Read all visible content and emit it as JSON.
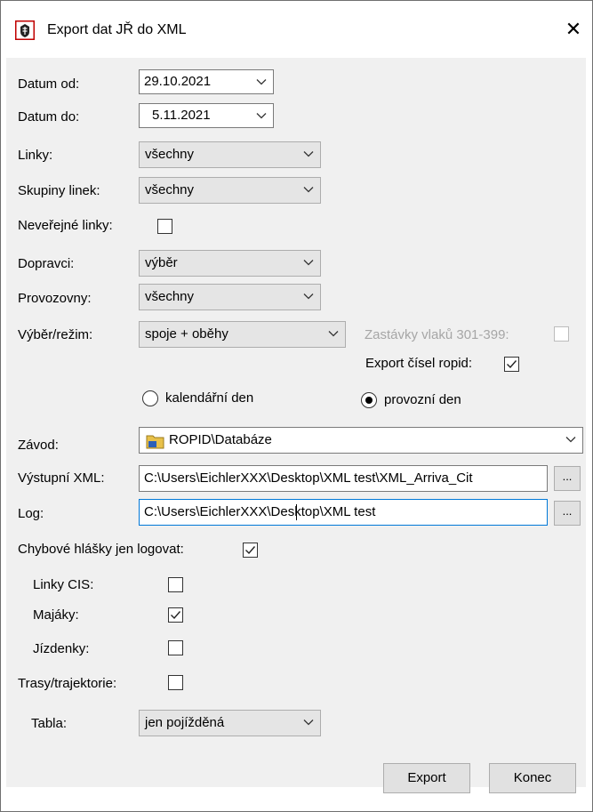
{
  "window": {
    "title": "Export dat JŘ do XML",
    "close_glyph": "✕",
    "icon": "app-icon"
  },
  "form": {
    "datum_od": {
      "label": "Datum od:",
      "value": "29.10.2021"
    },
    "datum_do": {
      "label": "Datum do:",
      "value": "5.11.2021"
    },
    "linky": {
      "label": "Linky:",
      "value": "všechny"
    },
    "skupiny_linek": {
      "label": "Skupiny linek:",
      "value": "všechny"
    },
    "neverejne_linky": {
      "label": "Neveřejné linky:",
      "checked": false
    },
    "dopravci": {
      "label": "Dopravci:",
      "value": "výběr"
    },
    "provozovny": {
      "label": "Provozovny:",
      "value": "všechny"
    },
    "vyber_rezim": {
      "label": "Výběr/režim:",
      "value": "spoje + oběhy"
    },
    "zastavky_vlaku": {
      "label": "Zastávky vlaků 301-399:",
      "checked": false,
      "enabled": false
    },
    "export_cisel_ropid": {
      "label": "Export čísel ropid:",
      "checked": true
    },
    "day_mode": {
      "options": [
        "kalendářní den",
        "provozní den"
      ],
      "selected": "provozní den"
    },
    "zavod": {
      "label": "Závod:",
      "value": "ROPID\\Databáze"
    },
    "vystupni_xml": {
      "label": "Výstupní XML:",
      "value": "C:\\Users\\EichlerXXX\\Desktop\\XML test\\XML_Arriva_Cit",
      "browse": "..."
    },
    "log": {
      "label": "Log:",
      "value": "C:\\Users\\EichlerXXX\\Desktop\\XML test",
      "browse": "..."
    },
    "chybove_hlasky": {
      "label": "Chybové hlášky jen logovat:",
      "checked": true
    },
    "linky_cis": {
      "label": "Linky CIS:",
      "checked": false
    },
    "majaky": {
      "label": "Majáky:",
      "checked": true
    },
    "jizdenky": {
      "label": "Jízdenky:",
      "checked": false
    },
    "trasy": {
      "label": "Trasy/trajektorie:",
      "checked": false
    },
    "tabla": {
      "label": "Tabla:",
      "value": "jen pojížděná"
    }
  },
  "buttons": {
    "export": "Export",
    "konec": "Konec"
  },
  "colors": {
    "client_bg": "#f0f0f0",
    "focus_border": "#0078d7",
    "app_icon_red": "#c00000"
  }
}
